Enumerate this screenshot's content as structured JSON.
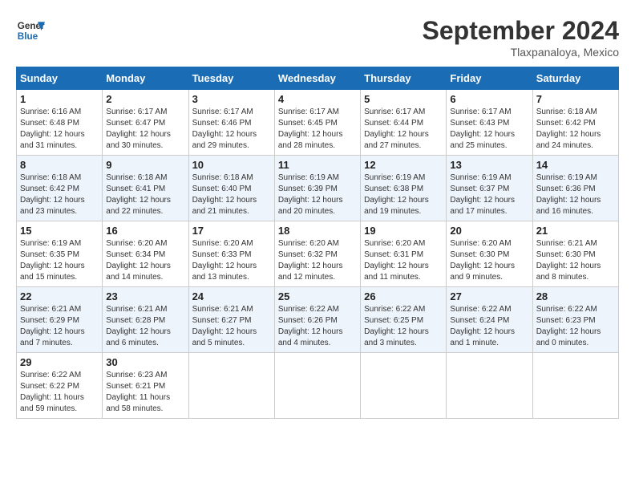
{
  "logo": {
    "line1": "General",
    "line2": "Blue"
  },
  "title": "September 2024",
  "location": "Tlaxpanaloya, Mexico",
  "days_of_week": [
    "Sunday",
    "Monday",
    "Tuesday",
    "Wednesday",
    "Thursday",
    "Friday",
    "Saturday"
  ],
  "weeks": [
    [
      {
        "day": "1",
        "sunrise": "6:16 AM",
        "sunset": "6:48 PM",
        "daylight": "12 hours and 31 minutes."
      },
      {
        "day": "2",
        "sunrise": "6:17 AM",
        "sunset": "6:47 PM",
        "daylight": "12 hours and 30 minutes."
      },
      {
        "day": "3",
        "sunrise": "6:17 AM",
        "sunset": "6:46 PM",
        "daylight": "12 hours and 29 minutes."
      },
      {
        "day": "4",
        "sunrise": "6:17 AM",
        "sunset": "6:45 PM",
        "daylight": "12 hours and 28 minutes."
      },
      {
        "day": "5",
        "sunrise": "6:17 AM",
        "sunset": "6:44 PM",
        "daylight": "12 hours and 27 minutes."
      },
      {
        "day": "6",
        "sunrise": "6:17 AM",
        "sunset": "6:43 PM",
        "daylight": "12 hours and 25 minutes."
      },
      {
        "day": "7",
        "sunrise": "6:18 AM",
        "sunset": "6:42 PM",
        "daylight": "12 hours and 24 minutes."
      }
    ],
    [
      {
        "day": "8",
        "sunrise": "6:18 AM",
        "sunset": "6:42 PM",
        "daylight": "12 hours and 23 minutes."
      },
      {
        "day": "9",
        "sunrise": "6:18 AM",
        "sunset": "6:41 PM",
        "daylight": "12 hours and 22 minutes."
      },
      {
        "day": "10",
        "sunrise": "6:18 AM",
        "sunset": "6:40 PM",
        "daylight": "12 hours and 21 minutes."
      },
      {
        "day": "11",
        "sunrise": "6:19 AM",
        "sunset": "6:39 PM",
        "daylight": "12 hours and 20 minutes."
      },
      {
        "day": "12",
        "sunrise": "6:19 AM",
        "sunset": "6:38 PM",
        "daylight": "12 hours and 19 minutes."
      },
      {
        "day": "13",
        "sunrise": "6:19 AM",
        "sunset": "6:37 PM",
        "daylight": "12 hours and 17 minutes."
      },
      {
        "day": "14",
        "sunrise": "6:19 AM",
        "sunset": "6:36 PM",
        "daylight": "12 hours and 16 minutes."
      }
    ],
    [
      {
        "day": "15",
        "sunrise": "6:19 AM",
        "sunset": "6:35 PM",
        "daylight": "12 hours and 15 minutes."
      },
      {
        "day": "16",
        "sunrise": "6:20 AM",
        "sunset": "6:34 PM",
        "daylight": "12 hours and 14 minutes."
      },
      {
        "day": "17",
        "sunrise": "6:20 AM",
        "sunset": "6:33 PM",
        "daylight": "12 hours and 13 minutes."
      },
      {
        "day": "18",
        "sunrise": "6:20 AM",
        "sunset": "6:32 PM",
        "daylight": "12 hours and 12 minutes."
      },
      {
        "day": "19",
        "sunrise": "6:20 AM",
        "sunset": "6:31 PM",
        "daylight": "12 hours and 11 minutes."
      },
      {
        "day": "20",
        "sunrise": "6:20 AM",
        "sunset": "6:30 PM",
        "daylight": "12 hours and 9 minutes."
      },
      {
        "day": "21",
        "sunrise": "6:21 AM",
        "sunset": "6:30 PM",
        "daylight": "12 hours and 8 minutes."
      }
    ],
    [
      {
        "day": "22",
        "sunrise": "6:21 AM",
        "sunset": "6:29 PM",
        "daylight": "12 hours and 7 minutes."
      },
      {
        "day": "23",
        "sunrise": "6:21 AM",
        "sunset": "6:28 PM",
        "daylight": "12 hours and 6 minutes."
      },
      {
        "day": "24",
        "sunrise": "6:21 AM",
        "sunset": "6:27 PM",
        "daylight": "12 hours and 5 minutes."
      },
      {
        "day": "25",
        "sunrise": "6:22 AM",
        "sunset": "6:26 PM",
        "daylight": "12 hours and 4 minutes."
      },
      {
        "day": "26",
        "sunrise": "6:22 AM",
        "sunset": "6:25 PM",
        "daylight": "12 hours and 3 minutes."
      },
      {
        "day": "27",
        "sunrise": "6:22 AM",
        "sunset": "6:24 PM",
        "daylight": "12 hours and 1 minute."
      },
      {
        "day": "28",
        "sunrise": "6:22 AM",
        "sunset": "6:23 PM",
        "daylight": "12 hours and 0 minutes."
      }
    ],
    [
      {
        "day": "29",
        "sunrise": "6:22 AM",
        "sunset": "6:22 PM",
        "daylight": "11 hours and 59 minutes."
      },
      {
        "day": "30",
        "sunrise": "6:23 AM",
        "sunset": "6:21 PM",
        "daylight": "11 hours and 58 minutes."
      },
      null,
      null,
      null,
      null,
      null
    ]
  ],
  "labels": {
    "sunrise_prefix": "Sunrise: ",
    "sunset_prefix": "Sunset: ",
    "daylight_prefix": "Daylight: "
  }
}
